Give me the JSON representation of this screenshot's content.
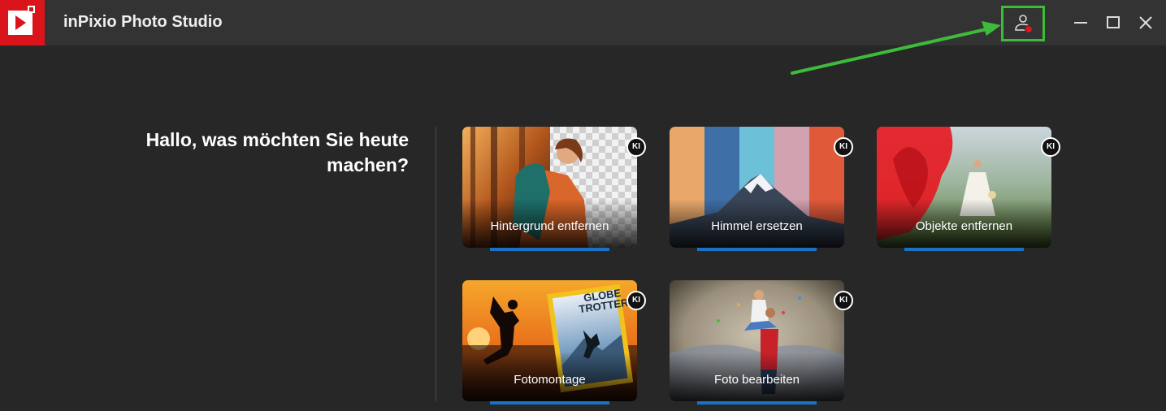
{
  "app": {
    "title": "inPixio Photo Studio"
  },
  "greeting": {
    "line1": "Hallo, was möchten Sie heute",
    "line2": "machen?"
  },
  "cards": [
    {
      "label": "Hintergrund entfernen",
      "badge": "KI"
    },
    {
      "label": "Himmel ersetzen",
      "badge": "KI"
    },
    {
      "label": "Objekte entfernen",
      "badge": "KI"
    },
    {
      "label": "Fotomontage",
      "badge": "KI",
      "magazine_text": [
        "GLOBE",
        "TROTTER"
      ]
    },
    {
      "label": "Foto bearbeiten",
      "badge": "KI"
    }
  ],
  "colors": {
    "brand": "#d9151b",
    "accent": "#1a72c6",
    "highlight": "#3dbb3a",
    "notification": "#e0141e"
  }
}
